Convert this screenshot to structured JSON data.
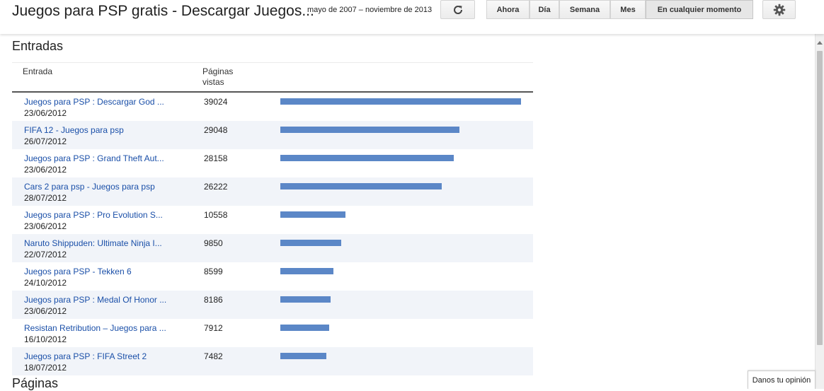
{
  "header": {
    "title": "Juegos para PSP gratis - Descargar Juegos...",
    "date_range": "mayo de 2007 – noviembre de 2013",
    "refresh_icon": "refresh-icon",
    "period_buttons": [
      "Ahora",
      "Día",
      "Semana",
      "Mes",
      "En cualquier momento"
    ],
    "active_period": "En cualquier momento",
    "settings_icon": "gear-icon"
  },
  "entries": {
    "section_title": "Entradas",
    "columns": [
      "Entrada",
      "Páginas vistas"
    ],
    "rows": [
      {
        "title": "Juegos para PSP : Descargar God ...",
        "date": "23/06/2012",
        "views": "39024",
        "value": 39024
      },
      {
        "title": "FIFA 12 - Juegos para psp",
        "date": "26/07/2012",
        "views": "29048",
        "value": 29048
      },
      {
        "title": "Juegos para PSP : Grand Theft Aut...",
        "date": "23/06/2012",
        "views": "28158",
        "value": 28158
      },
      {
        "title": "Cars 2 para psp - Juegos para psp",
        "date": "28/07/2012",
        "views": "26222",
        "value": 26222
      },
      {
        "title": "Juegos para PSP : Pro Evolution S...",
        "date": "23/06/2012",
        "views": "10558",
        "value": 10558
      },
      {
        "title": "Naruto Shippuden: Ultimate Ninja I...",
        "date": "22/07/2012",
        "views": "9850",
        "value": 9850
      },
      {
        "title": "Juegos para PSP - Tekken 6",
        "date": "24/10/2012",
        "views": "8599",
        "value": 8599
      },
      {
        "title": "Juegos para PSP : Medal Of Honor ...",
        "date": "23/06/2012",
        "views": "8186",
        "value": 8186
      },
      {
        "title": "Resistan Retribution – Juegos para ...",
        "date": "16/10/2012",
        "views": "7912",
        "value": 7912
      },
      {
        "title": "Juegos para PSP : FIFA Street 2",
        "date": "18/07/2012",
        "views": "7482",
        "value": 7482
      }
    ]
  },
  "pages_section": {
    "section_title": "Páginas"
  },
  "feedback": {
    "label": "Danos tu opinión"
  },
  "colors": {
    "bar": "#5b87c7",
    "link": "#1a4fa8",
    "row_alt": "#f1f4f9"
  }
}
